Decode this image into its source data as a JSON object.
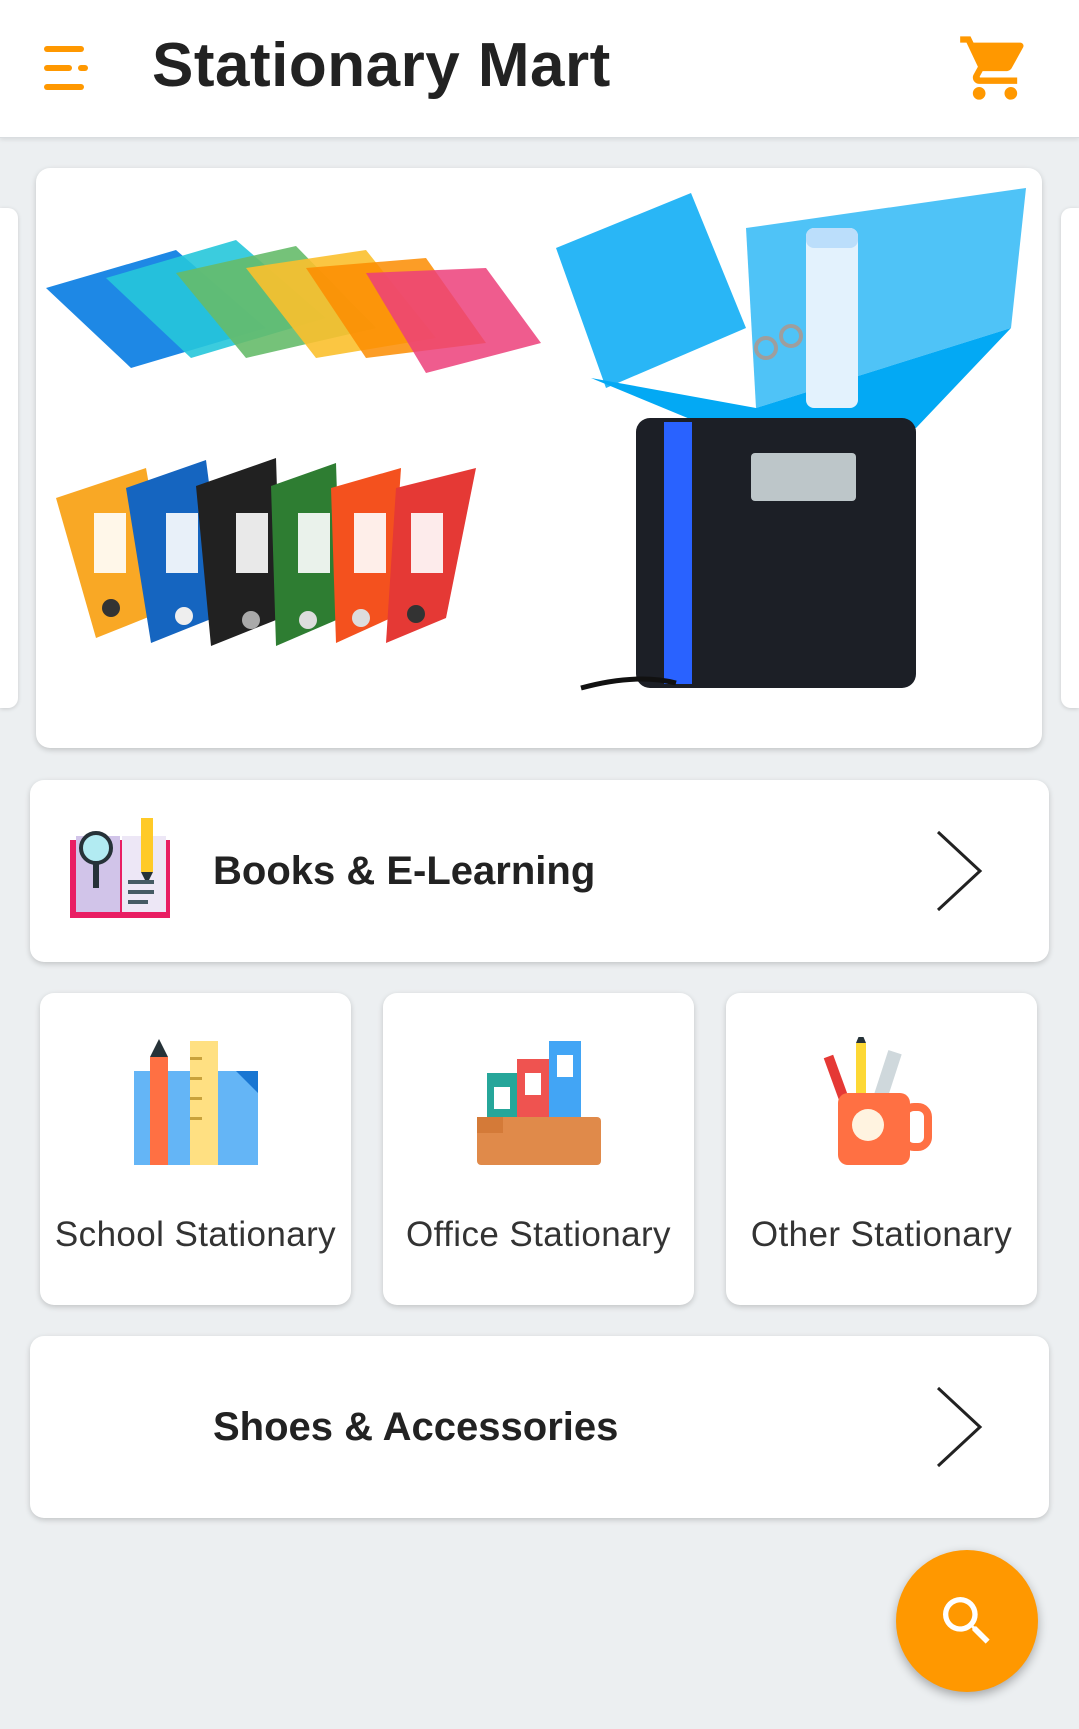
{
  "app": {
    "title": "Stationary Mart",
    "accent_color": "#ff9800",
    "menu_icon": "menu-icon",
    "cart_icon": "shopping-cart-icon"
  },
  "banner": {
    "image": "files-and-folders-banner"
  },
  "categories": {
    "books": {
      "label": "Books & E-Learning",
      "icon": "book-search-icon"
    },
    "tiles": [
      {
        "label": "School Stationary",
        "icon": "school-supplies-icon"
      },
      {
        "label": "Office Stationary",
        "icon": "office-files-icon"
      },
      {
        "label": "Other Stationary",
        "icon": "pen-cup-icon"
      }
    ],
    "shoes": {
      "label": "Shoes & Accessories"
    }
  },
  "fab": {
    "icon": "search-icon"
  }
}
